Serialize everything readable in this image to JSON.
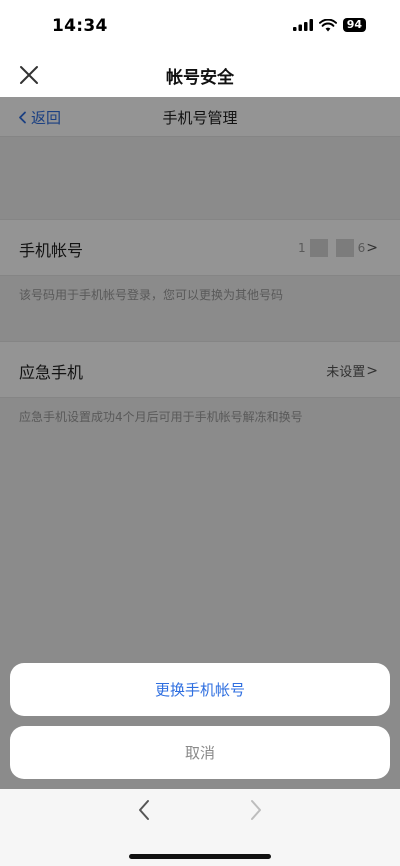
{
  "status_bar": {
    "time": "14:34",
    "battery": "94",
    "icons": [
      "signal-icon",
      "wifi-icon",
      "battery-icon"
    ]
  },
  "header": {
    "title": "帐号安全",
    "close_icon": "close-icon"
  },
  "sub_header": {
    "back_label": "返回",
    "title": "手机号管理"
  },
  "phone_row": {
    "label": "手机帐号",
    "value_first": "1",
    "value_last": "6",
    "chevron": ">"
  },
  "phone_hint": "该号码用于手机帐号登录，您可以更换为其他号码",
  "emergency_row": {
    "label": "应急手机",
    "value": "未设置",
    "chevron": ">"
  },
  "emergency_hint": "应急手机设置成功4个月后可用于手机帐号解冻和换号",
  "action_sheet": {
    "primary_label": "更换手机帐号",
    "cancel_label": "取消"
  },
  "colors": {
    "accent": "#2f6fe0",
    "overlay": "rgba(0,0,0,0.42)"
  }
}
